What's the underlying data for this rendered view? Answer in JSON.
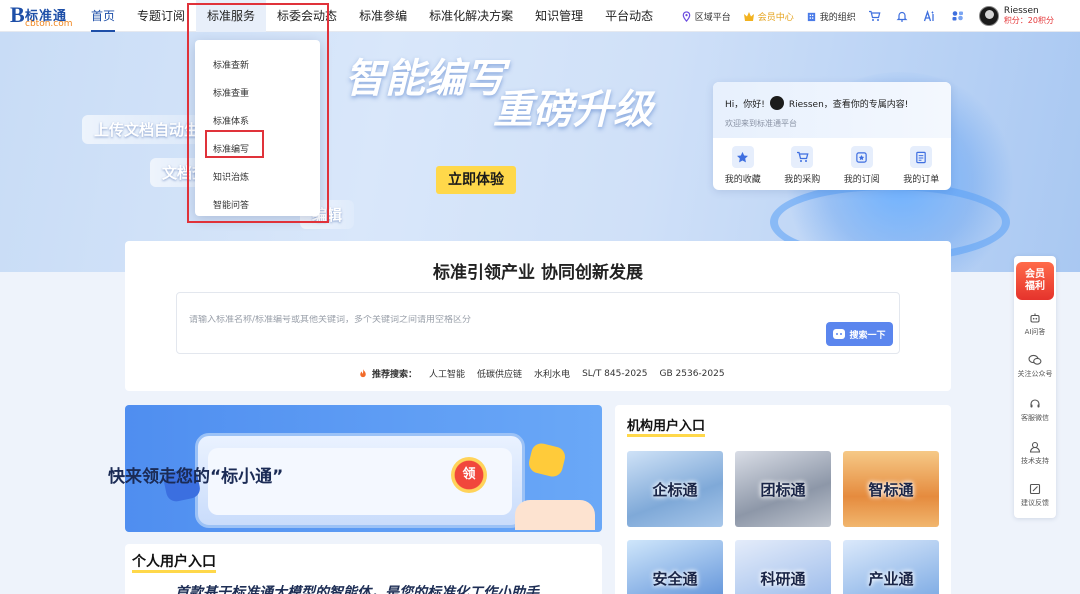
{
  "header": {
    "logo": {
      "letter": "B",
      "name": "标准通",
      "domain": "cbton.com"
    },
    "nav": [
      "首页",
      "专题订阅",
      "标准服务",
      "标委会动态",
      "标准参编",
      "标准化解决方案",
      "知识管理",
      "平台动态"
    ],
    "active_nav": "首页",
    "tools": {
      "region": "区域平台",
      "vip": "会员中心",
      "org": "我的组织"
    },
    "user": {
      "name": "Riessen",
      "points": "积分：20积分"
    }
  },
  "dropdown": {
    "items": [
      "标准查新",
      "标准查重",
      "标准体系",
      "标准编写",
      "知识治炼",
      "智能问答"
    ],
    "highlighted": "标准编写"
  },
  "hero": {
    "slogan_1": "智能编写",
    "slogan_2": "重磅升级",
    "feature_1": "上传文档自动生成",
    "feature_2": "文档查重",
    "feature_3": "编辑",
    "cta": "立即体验"
  },
  "welcome": {
    "greeting": "Hi，你好!",
    "greeting_tail": "Riessen，查看你的专属内容!",
    "subtitle": "欢迎来到标准通平台",
    "actions": [
      "我的收藏",
      "我的采购",
      "我的订阅",
      "我的订单"
    ]
  },
  "search": {
    "title": "标准引领产业 协同创新发展",
    "placeholder": "请输入标准名称/标准编号或其他关键词，多个关键词之间请用空格区分",
    "button": "搜索一下",
    "rec_label": "推荐搜索：",
    "keywords": [
      "人工智能",
      "低碳供应链",
      "水利水电",
      "SL/T 845-2025",
      "GB 2536-2025"
    ]
  },
  "promo": {
    "text": "快来领走您的“标小通”",
    "coin": "领"
  },
  "personal": {
    "title": "个人用户入口",
    "desc": "首款基于标准通大模型的智能体，是您的标准化工作小助手"
  },
  "institution": {
    "title": "机构用户入口",
    "tiles": [
      "企标通",
      "团标通",
      "智标通",
      "安全通",
      "科研通",
      "产业通"
    ]
  },
  "side": {
    "member": [
      "会员",
      "福利"
    ],
    "items": [
      "AI问答",
      "关注公众号",
      "客服微信",
      "技术支持",
      "建议反馈"
    ]
  },
  "colors": {
    "brand": "#1e4fa8",
    "accent_yellow": "#ffd84a",
    "highlight_red": "#e0323a",
    "search_button": "#5b86ee"
  }
}
